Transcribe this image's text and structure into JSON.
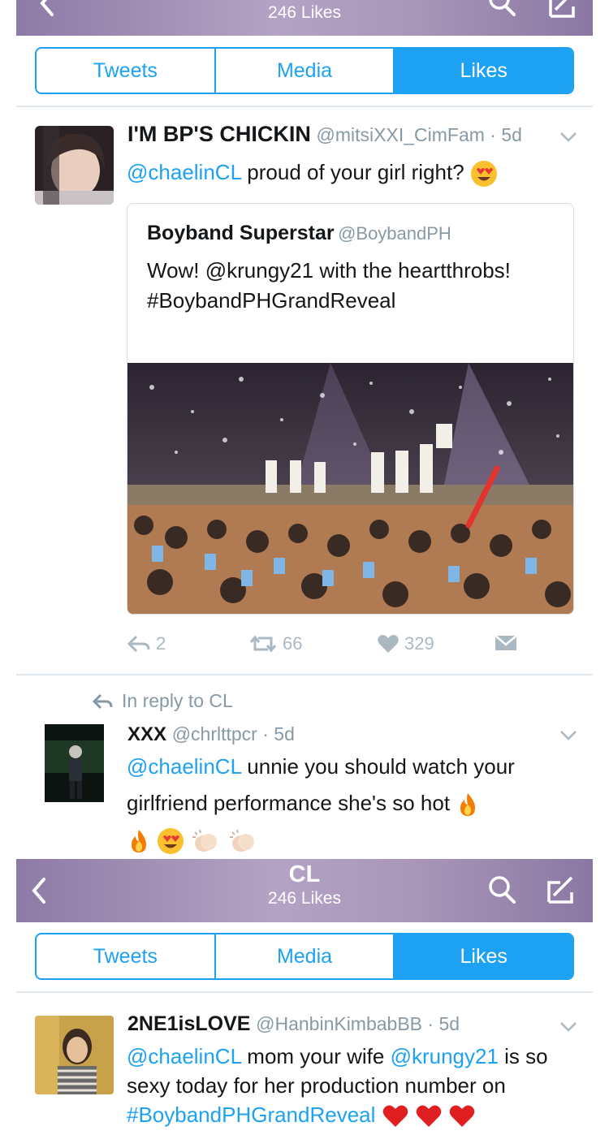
{
  "nav_top": {
    "subtitle": "246 Likes"
  },
  "nav_bottom": {
    "title": "CL",
    "subtitle": "246 Likes"
  },
  "tabs": [
    {
      "label": "Tweets"
    },
    {
      "label": "Media"
    },
    {
      "label": "Likes"
    }
  ],
  "tweet1": {
    "name": "I'M BP'S CHICKIN",
    "handle": "@mitsiXXI_CimFam",
    "time": "5d",
    "mention": "@chaelinCL",
    "text": " proud of your girl right?",
    "quote": {
      "name": "Boyband Superstar",
      "handle": "@BoybandPH",
      "text": "Wow! @krungy21 with the heartthrobs! #BoybandPHGrandReveal"
    },
    "actions": {
      "replies": "2",
      "retweets": "66",
      "likes": "329"
    }
  },
  "tweet2": {
    "reply_context": "In reply to CL",
    "name": "XXX",
    "handle": "@chrlttpcr",
    "time": "5d",
    "mention": "@chaelinCL",
    "text": " unnie you should watch your girlfriend performance she's so hot"
  },
  "tweet3": {
    "name": "2NE1isLOVE",
    "handle": "@HanbinKimbabBB",
    "time": "5d",
    "mention1": "@chaelinCL",
    "text1": " mom your wife ",
    "mention2": "@krungy21",
    "text2": " is so sexy today for her production number on ",
    "hashtag": "#BoybandPHGrandReveal"
  },
  "colors": {
    "accent": "#1da1f2",
    "nav_gradient": "#a895b8",
    "meta_gray": "#8899a6"
  }
}
